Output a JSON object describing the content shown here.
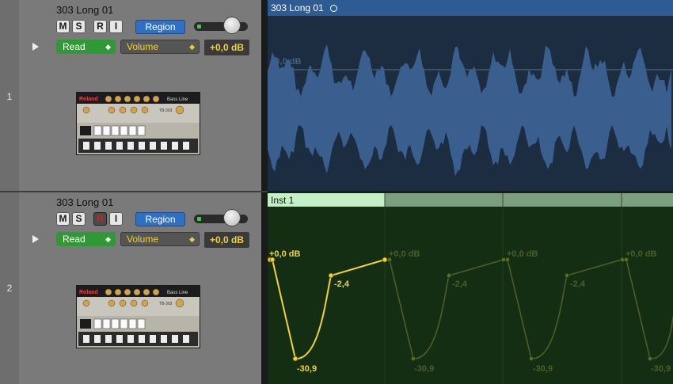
{
  "tracks": [
    {
      "number": "1",
      "name": "303 Long 01",
      "buttons": {
        "mute": "M",
        "solo": "S",
        "record": "R",
        "input": "I",
        "region": "Region"
      },
      "automation": {
        "mode": "Read",
        "parameter": "Volume",
        "value": "+0,0 dB"
      },
      "plugin": {
        "brand": "Roland",
        "product": "Bass Line",
        "model": "TB-303"
      },
      "record_armed": false
    },
    {
      "number": "2",
      "name": "303 Long 01",
      "buttons": {
        "mute": "M",
        "solo": "S",
        "record": "R",
        "input": "I",
        "region": "Region"
      },
      "automation": {
        "mode": "Read",
        "parameter": "Volume",
        "value": "+0,0 dB"
      },
      "plugin": {
        "brand": "Roland",
        "product": "Bass Line",
        "model": "TB-303"
      },
      "record_armed": true
    }
  ],
  "regions": {
    "audio": {
      "name": "303 Long 01",
      "level_label": "+0,0 dB",
      "color": "#2e5c92"
    },
    "midi": {
      "name": "Inst 1",
      "color": "#c3f0c6"
    }
  },
  "automation_curve": {
    "active_labels": {
      "start": "+0,0 dB",
      "min": "-30,9",
      "mid": "-2,4"
    },
    "ghost_labels": {
      "start": "+0,0 dB",
      "min": "-30,9",
      "mid": "-2,4"
    },
    "curve_color": "#f2d233"
  }
}
